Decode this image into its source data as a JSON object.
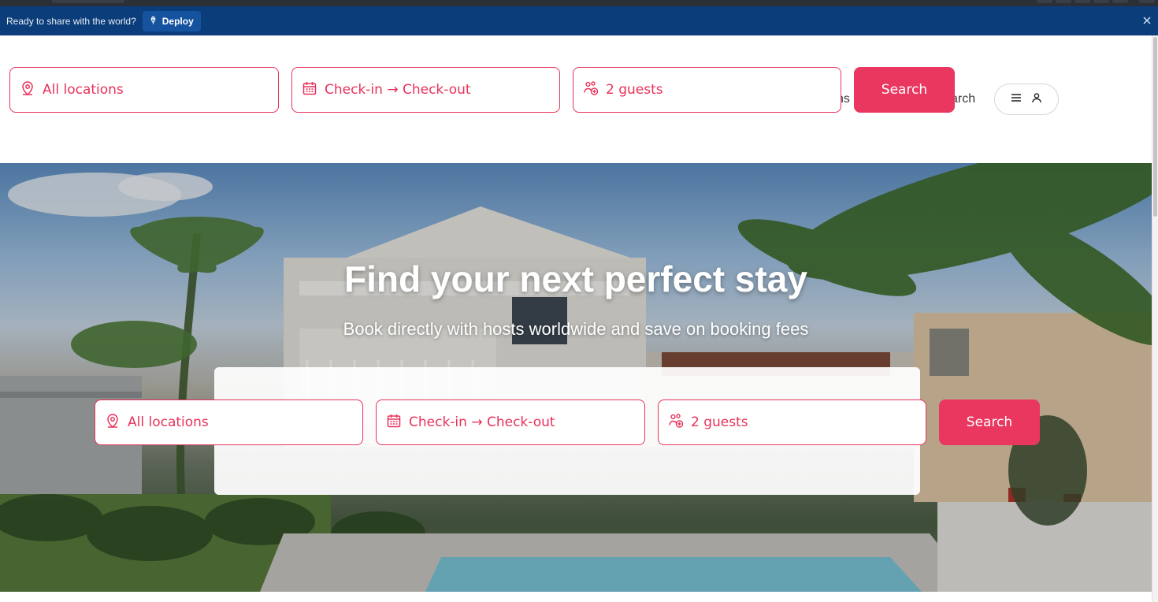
{
  "deploy_bar": {
    "message": "Ready to share with the world?",
    "deploy_label": "Deploy"
  },
  "header": {
    "search": {
      "location": "All locations",
      "dates": "Check-in → Check-out",
      "guests": "2 guests",
      "button": "Search"
    },
    "partial_link_left": "ns",
    "partial_link_right": "arch"
  },
  "hero": {
    "title": "Find your next perfect stay",
    "subtitle": "Book directly with hosts worldwide and save on booking fees",
    "search": {
      "location": "All locations",
      "dates": "Check-in → Check-out",
      "guests": "2 guests",
      "button": "Search"
    }
  },
  "colors": {
    "accent": "#ea3760",
    "deploy_bar": "#0b3d7a"
  },
  "icons": [
    "rocket-icon",
    "close-icon",
    "location-pin-icon",
    "calendar-icon",
    "guests-icon",
    "hamburger-icon",
    "user-icon"
  ]
}
